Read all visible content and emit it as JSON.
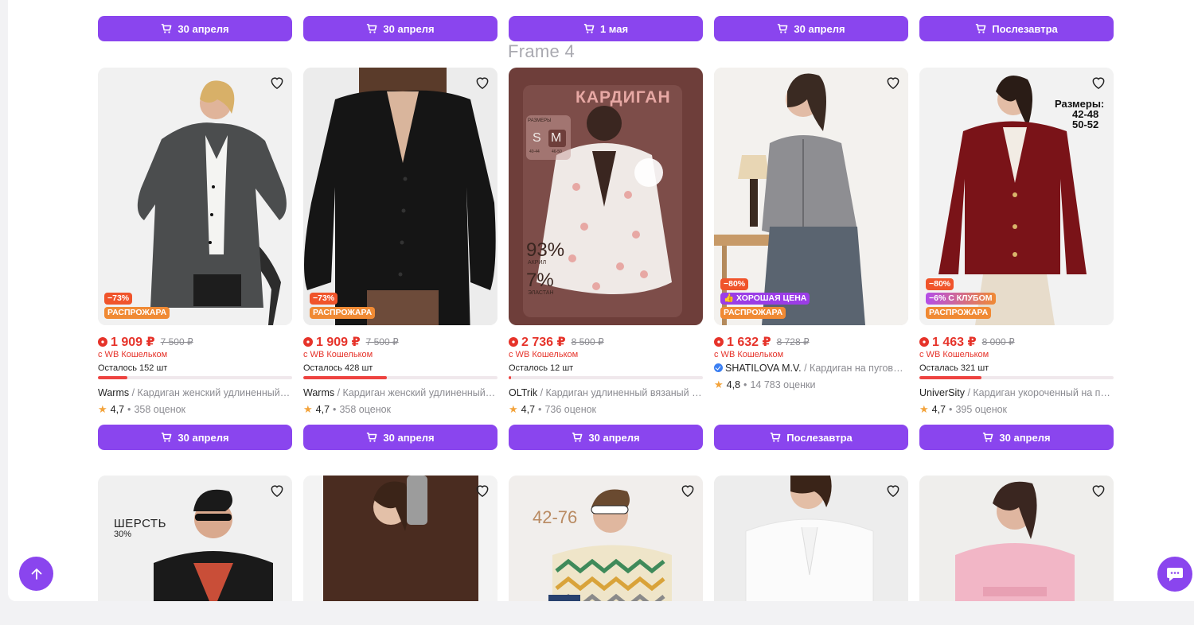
{
  "frame_label": "Frame 4",
  "top_row_buttons": [
    "30 апреля",
    "30 апреля",
    "1 мая",
    "30 апреля",
    "Послезавтра"
  ],
  "colors": {
    "accent": "#8a45ee",
    "price": "#e6332a",
    "discount_badge": "#f0542b",
    "fire_badge": "#f08a34",
    "good_price_badge": "#9b3de6",
    "rating_star": "#f3a33b"
  },
  "products": [
    {
      "price": "1 909 ₽",
      "old_price": "7 500 ₽",
      "wallet": "с WB Кошельком",
      "stock": "Осталось 152 шт",
      "stock_fraction": 0.15,
      "brand": "Warms",
      "name": " / Кардиган женский удлиненный оверсайз",
      "rating": "4,7",
      "reviews": "358 оценок",
      "badges": [
        "−73%",
        "РАСПРОЖАРА"
      ],
      "button": "30 апреля"
    },
    {
      "price": "1 909 ₽",
      "old_price": "7 500 ₽",
      "wallet": "с WB Кошельком",
      "stock": "Осталось 428 шт",
      "stock_fraction": 0.43,
      "brand": "Warms",
      "name": " / Кардиган женский удлиненный оверсайз",
      "rating": "4,7",
      "reviews": "358 оценок",
      "badges": [
        "−73%",
        "РАСПРОЖАРА"
      ],
      "button": "30 апреля"
    },
    {
      "price": "2 736 ₽",
      "old_price": "8 500 ₽",
      "wallet": "с WB Кошельком",
      "stock": "Осталось 12 шт",
      "stock_fraction": 0.01,
      "brand": "OLTrik",
      "name": " / Кардиган удлиненный вязаный с цветами",
      "rating": "4,7",
      "reviews": "736 оценок",
      "badges": [],
      "button": "30 апреля",
      "image_text": {
        "title": "КАРДИГАН",
        "sizes_label": "РАЗМЕРЫ",
        "size_s": "S",
        "size_m": "M",
        "range_s": "40-44",
        "range_m": "46-50",
        "pct1": "93%",
        "mat1": "АКРИЛ",
        "pct2": "7%",
        "mat2": "ЭЛАСТАН"
      }
    },
    {
      "price": "1 632 ₽",
      "old_price": "8 728 ₽",
      "wallet": "с WB Кошельком",
      "stock": "",
      "stock_fraction": null,
      "brand": "SHATILOVA M.V.",
      "name": " / Кардиган на пуговицах укороченный",
      "rating": "4,8",
      "reviews": "14 783 оценки",
      "badges": [
        "−80%",
        "ХОРОШАЯ ЦЕНА",
        "РАСПРОЖАРА"
      ],
      "button": "Послезавтра"
    },
    {
      "price": "1 463 ₽",
      "old_price": "8 000 ₽",
      "wallet": "с WB Кошельком",
      "stock": "Осталась 321 шт",
      "stock_fraction": 0.32,
      "brand": "UniverSity",
      "name": " / Кардиган укороченный на пуговицах",
      "rating": "4,7",
      "reviews": "395 оценок",
      "badges": [
        "−80%",
        "−6% С КЛУБОМ",
        "РАСПРОЖАРА"
      ],
      "button": "30 апреля",
      "image_text": {
        "line1": "Размеры:",
        "line2": "42-48",
        "line3": "50-52"
      }
    }
  ],
  "bottom_row_image_text": {
    "wool": "ШЕРСТЬ",
    "wool_pct": "30%",
    "sizes": "42-76"
  }
}
